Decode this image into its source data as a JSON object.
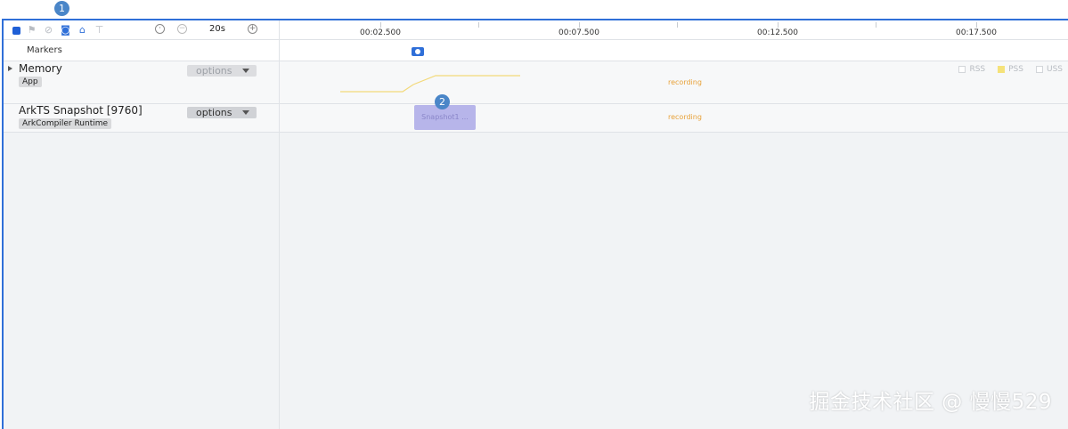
{
  "toolbar": {
    "icons": [
      "record-stop-icon",
      "flag-icon",
      "gc-icon",
      "camera-icon",
      "building-icon",
      "filter-icon"
    ],
    "clock_icon": "clock-icon",
    "zoom_out_icon": "zoom-out-icon",
    "zoom_value": "20s",
    "zoom_in_icon": "zoom-in-icon"
  },
  "timeline": {
    "ticks": [
      "00:02.500",
      "00:07.500",
      "00:12.500",
      "00:17.500"
    ]
  },
  "markers": {
    "label": "Markers"
  },
  "tracks": [
    {
      "title": "Memory",
      "tag": "App",
      "options_label": "options",
      "status": "recording"
    },
    {
      "title": "ArkTS Snapshot [9760]",
      "tag": "ArkCompiler Runtime",
      "options_label": "options",
      "status": "recording",
      "snapshot_label": "Snapshot1 ..."
    }
  ],
  "legend": [
    {
      "label": "RSS"
    },
    {
      "label": "PSS"
    },
    {
      "label": "USS"
    }
  ],
  "badges": [
    "1",
    "2"
  ],
  "watermark": "掘金技术社区 @ 慢慢529",
  "colors": {
    "accent": "#2f6fd8",
    "recording": "#e8a23a",
    "pss": "#f5e27a",
    "snapshot_block": "#b7b5ea"
  }
}
